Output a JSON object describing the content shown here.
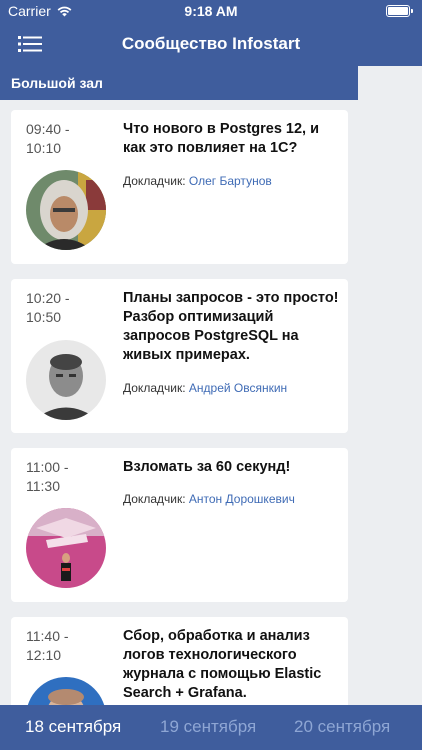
{
  "status_bar": {
    "carrier": "Carrier",
    "time": "9:18 AM"
  },
  "nav": {
    "title": "Сообщество Infostart",
    "menu_icon": "hamburger-menu-icon"
  },
  "hall": {
    "name": "Большой зал"
  },
  "talks": [
    {
      "time": "09:40 - 10:10",
      "title": "Что нового в Postgres 12, и как это повлияет на 1С?",
      "speaker_label": "Докладчик:",
      "speaker_name": "Олег Бартунов"
    },
    {
      "time": "10:20 - 10:50",
      "title": "Планы запросов - это просто! Разбор оптимизаций запросов PostgreSQL на живых примерах.",
      "speaker_label": "Докладчик:",
      "speaker_name": "Андрей Овсянкин"
    },
    {
      "time": "11:00 - 11:30",
      "title": "Взломать за 60 секунд!",
      "speaker_label": "Докладчик:",
      "speaker_name": "Антон Дорошкевич"
    },
    {
      "time": "11:40 - 12:10",
      "title": "Сбор, обработка и анализ логов технологического журнала с помощью Elastic Search + Grafana.",
      "speaker_label": "",
      "speaker_name": ""
    }
  ],
  "tabs": [
    {
      "label": "18 сентября",
      "active": true
    },
    {
      "label": "19 сентября",
      "active": false
    },
    {
      "label": "20 сентября",
      "active": false
    }
  ],
  "colors": {
    "brand": "#3f5d9d",
    "link": "#3f6bb5",
    "background": "#eceef1"
  }
}
